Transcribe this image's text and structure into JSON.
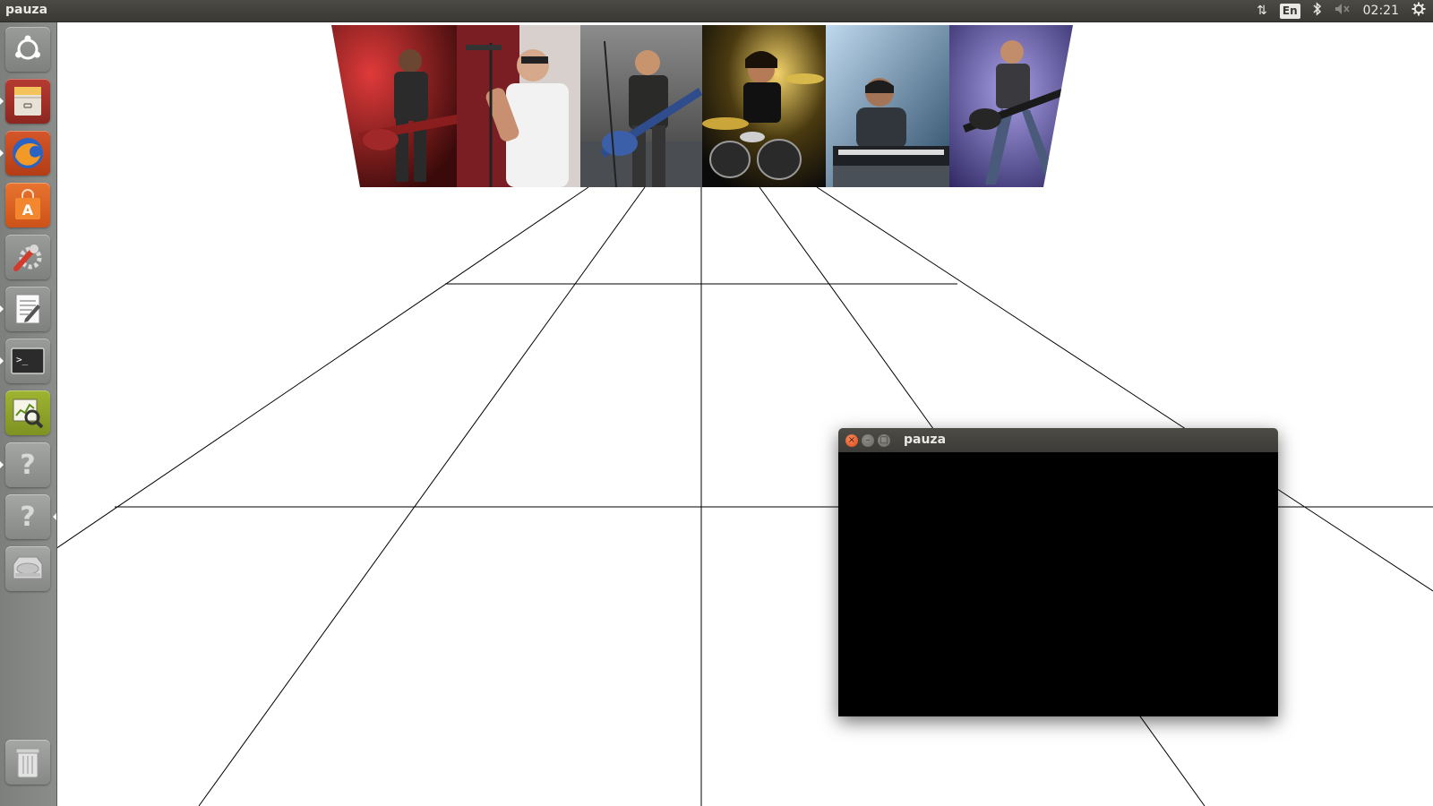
{
  "top_panel": {
    "app_title": "pauza",
    "indicators": {
      "network_icon": "transfer-arrows-icon",
      "language": "En",
      "bluetooth_icon": "bluetooth-icon",
      "volume_icon": "volume-muted-icon",
      "clock": "02:21",
      "settings_icon": "gear-icon"
    }
  },
  "launcher": {
    "items": [
      {
        "name": "ubuntu-dash",
        "icon": "ubuntu-logo-icon"
      },
      {
        "name": "files",
        "icon": "file-cabinet-icon"
      },
      {
        "name": "firefox",
        "icon": "firefox-icon"
      },
      {
        "name": "software-center",
        "icon": "shopping-bag-icon"
      },
      {
        "name": "system-settings",
        "icon": "wrench-gear-icon"
      },
      {
        "name": "text-editor",
        "icon": "text-editor-icon"
      },
      {
        "name": "terminal",
        "icon": "terminal-icon"
      },
      {
        "name": "system-monitor",
        "icon": "magnifier-chart-icon"
      },
      {
        "name": "unknown-app-1",
        "icon": "question-mark-icon"
      },
      {
        "name": "unknown-app-2",
        "icon": "question-mark-icon"
      },
      {
        "name": "drive",
        "icon": "hard-drive-icon"
      },
      {
        "name": "trash",
        "icon": "trash-icon"
      }
    ],
    "help_glyph": "?",
    "terminal_prompt": ">_"
  },
  "scene": {
    "photo_panels": [
      {
        "subject": "guitarist-red-lights"
      },
      {
        "subject": "vocalist-microphone"
      },
      {
        "subject": "guitarist-blue-guitar"
      },
      {
        "subject": "drummer-drumkit"
      },
      {
        "subject": "keyboardist"
      },
      {
        "subject": "bassist-purple-light"
      }
    ]
  },
  "app_window": {
    "title": "pauza",
    "close_glyph": "×",
    "minimize_glyph": "–",
    "maximize_glyph": "□"
  }
}
